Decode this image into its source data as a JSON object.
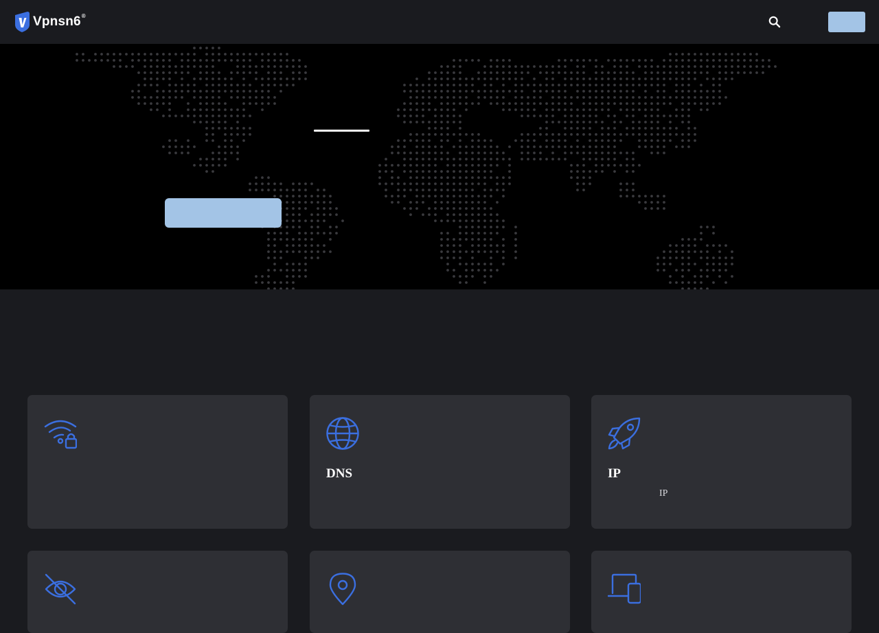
{
  "brand": {
    "name": "Vpnsn6",
    "registered_mark": "®",
    "accent_color": "#3b6fe0",
    "cta_color": "#a3c4e6"
  },
  "nav": {
    "search_icon": "search-icon",
    "cta_label": ""
  },
  "hero": {
    "title": "",
    "cta_label": "",
    "dot_color": "#3a3a3e"
  },
  "features": [
    {
      "icon": "wifi-lock-icon",
      "title": "",
      "desc": ""
    },
    {
      "icon": "globe-icon",
      "title": "DNS",
      "desc": ""
    },
    {
      "icon": "rocket-icon",
      "title": "IP",
      "desc": "IP"
    },
    {
      "icon": "eye-slash-icon",
      "title": "",
      "desc": ""
    },
    {
      "icon": "map-pin-icon",
      "title": "",
      "desc": ""
    },
    {
      "icon": "devices-icon",
      "title": "",
      "desc": ""
    }
  ]
}
